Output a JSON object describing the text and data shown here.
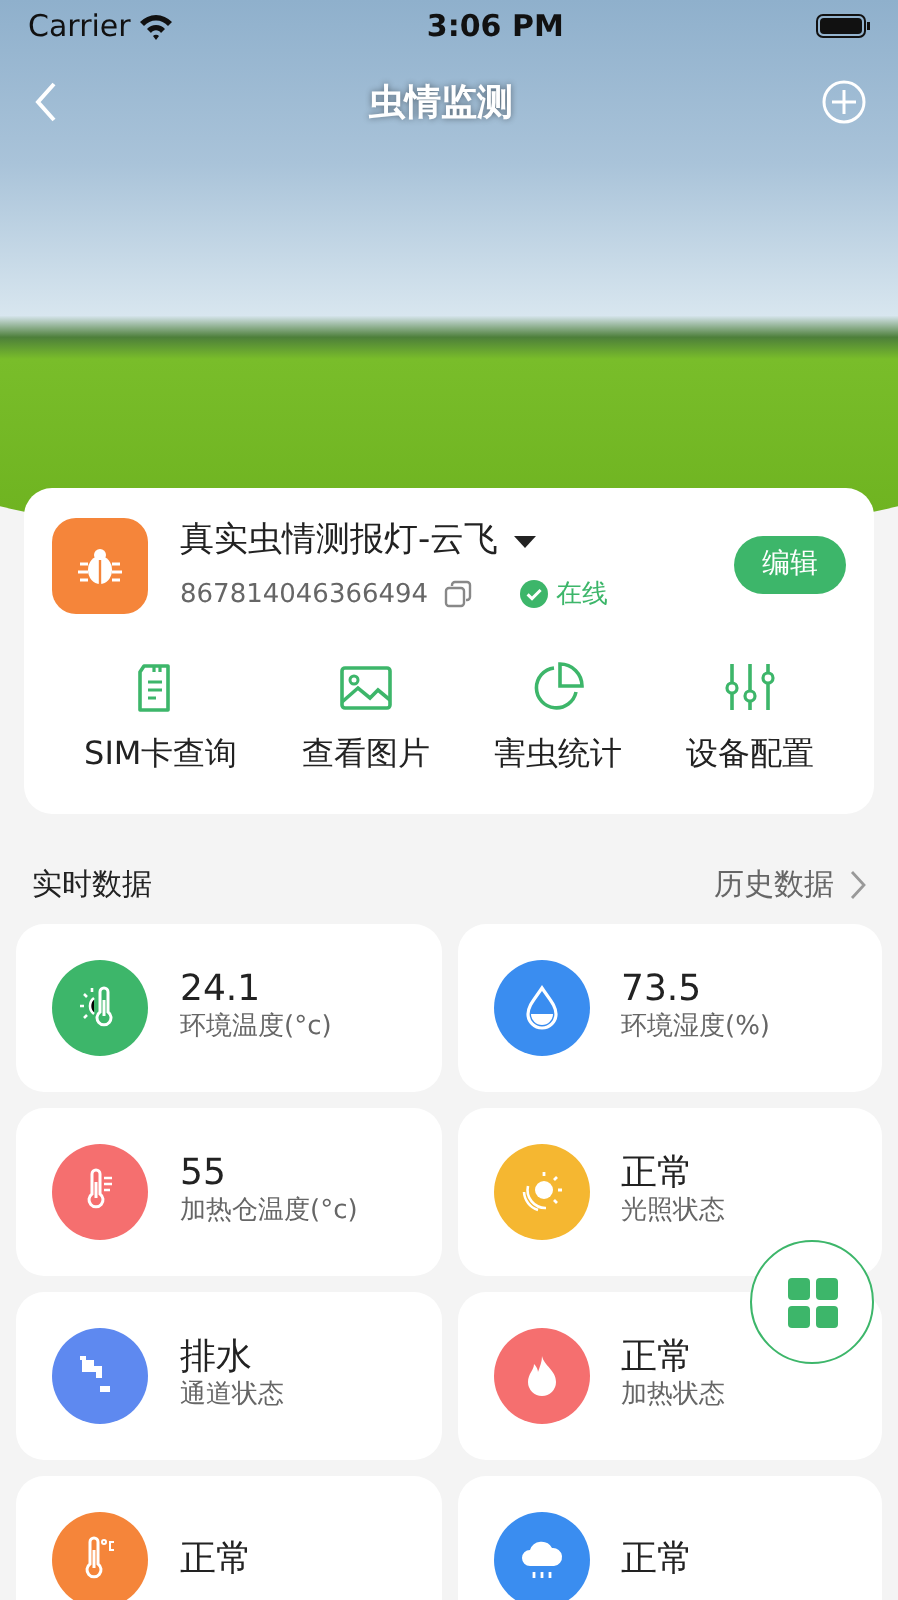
{
  "status_bar": {
    "carrier": "Carrier",
    "time": "3:06 PM"
  },
  "nav": {
    "title": "虫情监测"
  },
  "device": {
    "name": "真实虫情测报灯-云飞",
    "id": "867814046366494",
    "status": "在线",
    "online": true,
    "edit_button": "编辑"
  },
  "actions": [
    {
      "label": "SIM卡查询"
    },
    {
      "label": "查看图片"
    },
    {
      "label": "害虫统计"
    },
    {
      "label": "设备配置"
    }
  ],
  "section": {
    "title": "实时数据",
    "link": "历史数据"
  },
  "metrics": [
    {
      "value": "24.1",
      "label": "环境温度(°c)",
      "color": "#3db66a"
    },
    {
      "value": "73.5",
      "label": "环境湿度(%)",
      "color": "#3a8df0"
    },
    {
      "value": "55",
      "label": "加热仓温度(°c)",
      "color": "#f56f6f"
    },
    {
      "value": "正常",
      "label": "光照状态",
      "color": "#f5b731"
    },
    {
      "value": "排水",
      "label": "通道状态",
      "color": "#5e89f0"
    },
    {
      "value": "正常",
      "label": "加热状态",
      "color": "#f56f6f"
    },
    {
      "value": "正常",
      "color": "#f5853a"
    },
    {
      "value": "正常",
      "color": "#3a8df0"
    }
  ]
}
